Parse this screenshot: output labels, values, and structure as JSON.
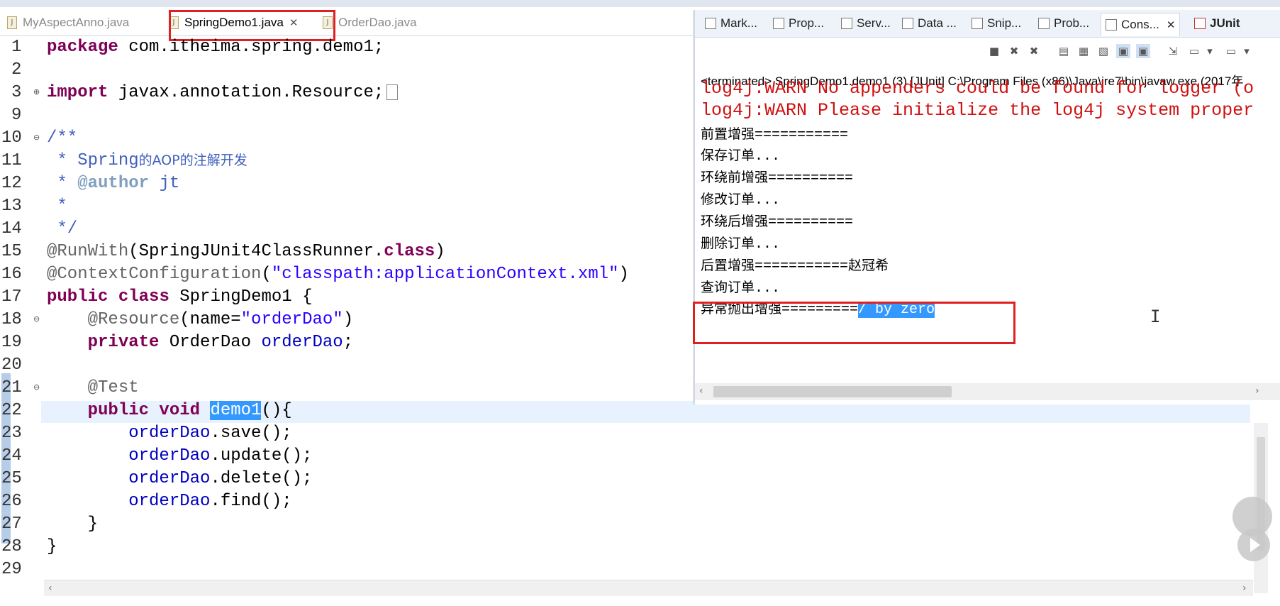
{
  "editor_tabs": [
    {
      "label": "MyAspectAnno.java",
      "active": false
    },
    {
      "label": "SpringDemo1.java",
      "active": true,
      "close": "✕"
    },
    {
      "label": "OrderDao.java",
      "active": false
    }
  ],
  "editor": {
    "line_numbers": [
      "1",
      "2",
      "3",
      "9",
      "10",
      "11",
      "12",
      "13",
      "14",
      "15",
      "16",
      "17",
      "18",
      "19",
      "20",
      "21",
      "22",
      "23",
      "24",
      "25",
      "26",
      "27",
      "28",
      "29"
    ],
    "code": {
      "l1_kw": "package",
      "l1_rest": " com.itheima.spring.demo1;",
      "l3_kw": "import",
      "l3_rest": " javax.annotation.Resource;",
      "l10": "/**",
      "l11_a": " * Spring",
      "l11_b": "的AOP的注解开发",
      "l12_a": " * ",
      "l12_tag": "@author",
      "l12_b": " jt",
      "l13": " *",
      "l14": " */",
      "l15_a": "@RunWith",
      "l15_b": "(SpringJUnit4ClassRunner.",
      "l15_kw": "class",
      "l15_c": ")",
      "l16_a": "@ContextConfiguration",
      "l16_b": "(",
      "l16_str": "\"classpath:applicationContext.xml\"",
      "l16_c": ")",
      "l17_kw1": "public",
      "l17_kw2": "class",
      "l17_rest": " SpringDemo1 {",
      "l18_a": "    @Resource",
      "l18_b": "(name=",
      "l18_str": "\"orderDao\"",
      "l18_c": ")",
      "l19_kw": "    private",
      "l19_b": " OrderDao ",
      "l19_fld": "orderDao",
      "l19_c": ";",
      "l21": "    @Test",
      "l22_kw1": "    public",
      "l22_kw2": " void",
      "l22_sp": " ",
      "l22_sel": "demo1",
      "l22_rest": "(){",
      "l23_fld": "        orderDao",
      "l23_rest": ".save();",
      "l24_fld": "        orderDao",
      "l24_rest": ".update();",
      "l25_fld": "        orderDao",
      "l25_rest": ".delete();",
      "l26_fld": "        orderDao",
      "l26_rest": ".find();",
      "l27": "    }",
      "l28": "}"
    }
  },
  "views": {
    "tabs": [
      "Mark...",
      "Prop...",
      "Serv...",
      "Data ...",
      "Snip...",
      "Prob...",
      "Cons...",
      "JUnit"
    ],
    "active": "Cons..."
  },
  "console": {
    "terminated": "<terminated> SpringDemo1.demo1 (3) [JUnit] C:\\Program Files (x86)\\Java\\jre7\\bin\\javaw.exe (2017年",
    "warn1": "log4j:WARN No appenders could be found for logger (o",
    "warn2": "log4j:WARN Please initialize the log4j system proper",
    "lines": [
      {
        "cn": "前置增强",
        "tail": "==========="
      },
      {
        "cn": "保存订单",
        "tail": "..."
      },
      {
        "cn": "环绕前增强",
        "tail": "=========="
      },
      {
        "cn": "修改订单",
        "tail": "..."
      },
      {
        "cn": "环绕后增强",
        "tail": "=========="
      },
      {
        "cn": "删除订单",
        "tail": "..."
      },
      {
        "cn": "后置增强",
        "tail": "===========",
        "cn2": "赵冠希"
      },
      {
        "cn": "查询订单",
        "tail": "..."
      }
    ],
    "last_cn": "异常抛出增强",
    "last_eq": "=========",
    "last_sel": "/ by zero"
  },
  "colors": {
    "keyword": "#7f0055",
    "string": "#2a00ff",
    "comment": "#3f5fbf",
    "warn": "#d01010",
    "selection": "#3399ff",
    "highlight_box": "#e02020"
  }
}
